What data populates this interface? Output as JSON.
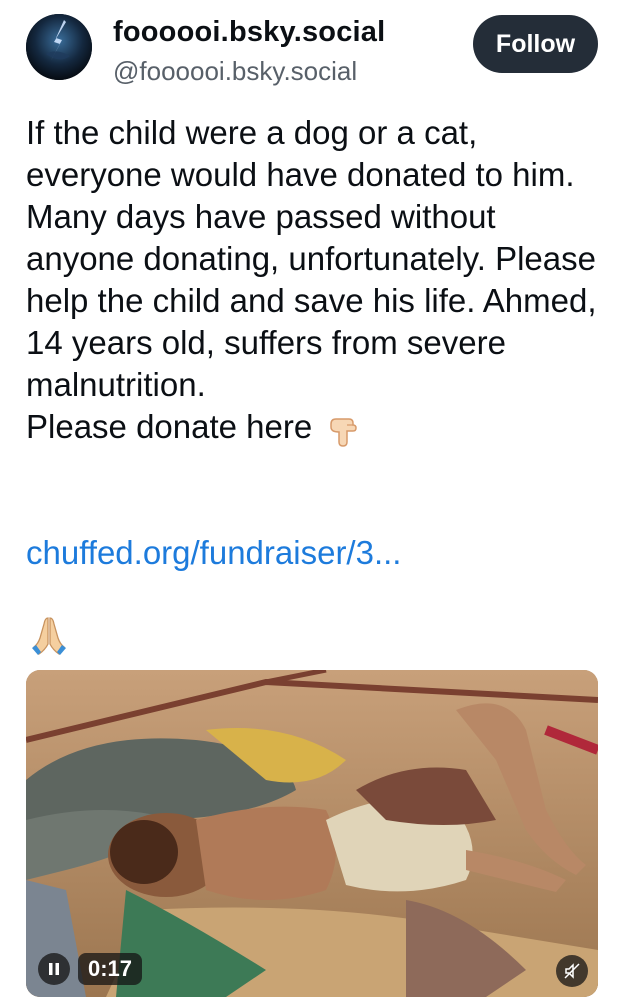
{
  "author": {
    "display_name": "foooooi.bsky.social",
    "handle": "@foooooi.bsky.social",
    "avatar_icon": "lightning-storm-avatar"
  },
  "follow_button": {
    "label": "Follow",
    "color": "#242d38"
  },
  "post": {
    "paragraphs": [
      "If the child were a dog or a cat, everyone would have donated to him.",
      "Many days have passed without anyone donating, unfortunately. Please help the child and save his life. Ahmed, 14 years old, suffers from severe malnutrition.",
      "Please donate here"
    ],
    "donate_emoji": "pointing-down-hand-icon",
    "link_text": "chuffed.org/fundraiser/3...",
    "link_color": "#1d7bdc",
    "closing_emoji": "folded-hands-icon"
  },
  "video": {
    "time": "0:17",
    "state": "playing",
    "muted": true
  }
}
